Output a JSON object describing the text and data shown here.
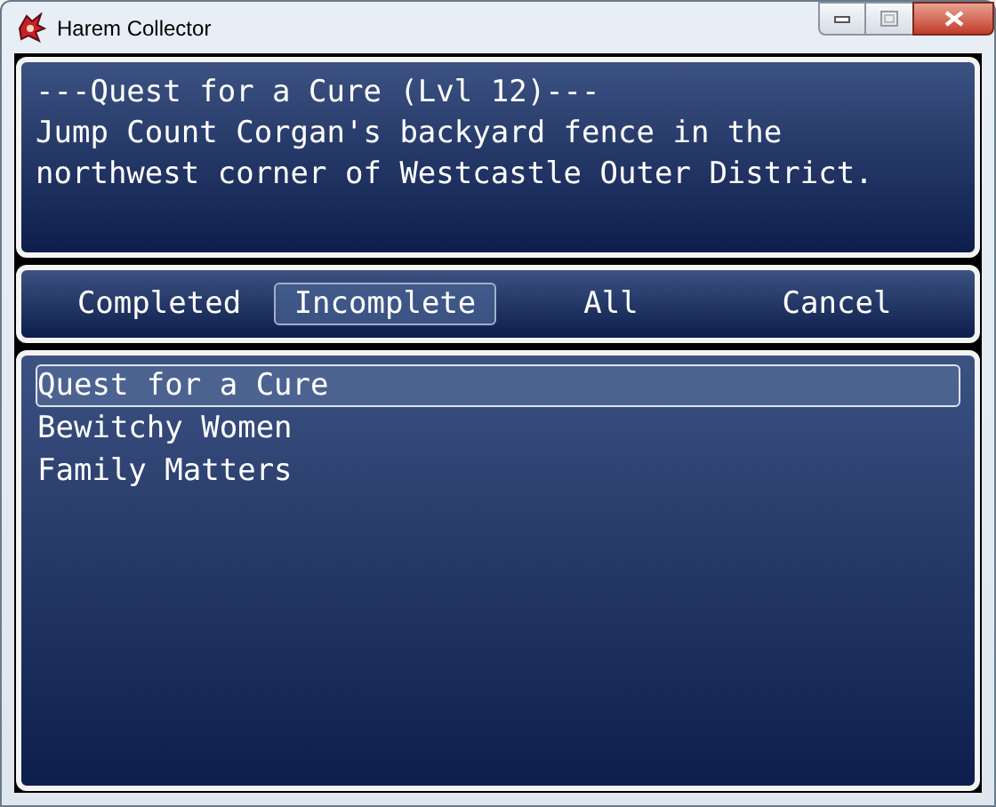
{
  "window": {
    "title": "Harem Collector"
  },
  "help": {
    "heading": "---Quest for a Cure (Lvl 12)---",
    "lines": [
      "Jump Count Corgan's backyard fence in the",
      "northwest corner of Westcastle Outer District."
    ]
  },
  "filters": [
    {
      "label": "Completed",
      "selected": false
    },
    {
      "label": "Incomplete",
      "selected": true
    },
    {
      "label": "All",
      "selected": false
    },
    {
      "label": "Cancel",
      "selected": false
    }
  ],
  "quests": [
    {
      "label": "Quest for a Cure",
      "selected": true
    },
    {
      "label": "Bewitchy Women",
      "selected": false
    },
    {
      "label": "Family Matters",
      "selected": false
    }
  ]
}
